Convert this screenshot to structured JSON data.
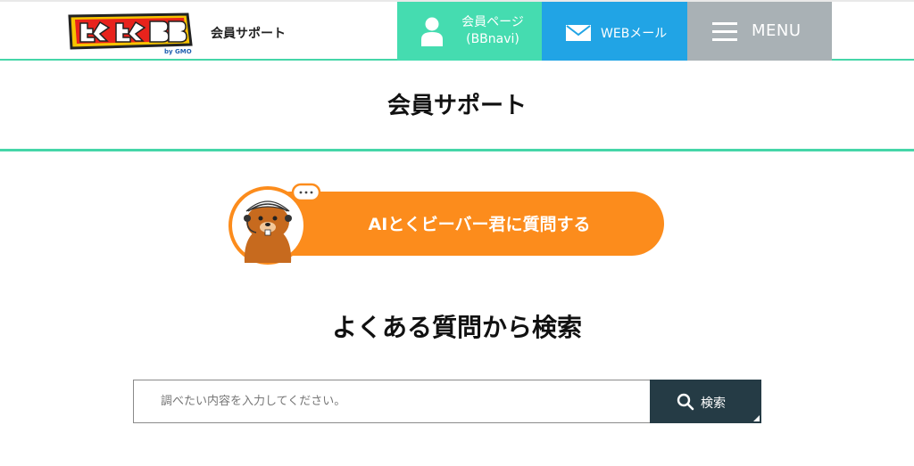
{
  "header": {
    "logo_alt": "とくとくBB by GMO",
    "logo_main": "とくとくBB",
    "logo_sub": "by GMO",
    "site_label": "会員サポート",
    "nav": {
      "member_line1": "会員ページ",
      "member_line2": "(BBnavi)",
      "member_icon": "person-icon",
      "mail_label": "WEBメール",
      "mail_icon": "mail-icon",
      "menu_label": "MENU",
      "menu_icon": "hamburger-icon"
    }
  },
  "page": {
    "title": "会員サポート"
  },
  "ai_button": {
    "label": "AIとくビーバー君に質問する",
    "mascot": "beaver-mascot-icon"
  },
  "faq": {
    "heading": "よくある質問から検索",
    "search_placeholder": "調べたい内容を入力してください。",
    "search_value": "",
    "search_button": "検索",
    "search_icon": "magnifier-icon"
  },
  "colors": {
    "accent_green": "#45dcb0",
    "mail_blue": "#21a4e5",
    "menu_gray": "#a9b1b5",
    "orange": "#fc8c1c",
    "search_dark": "#253b45"
  }
}
